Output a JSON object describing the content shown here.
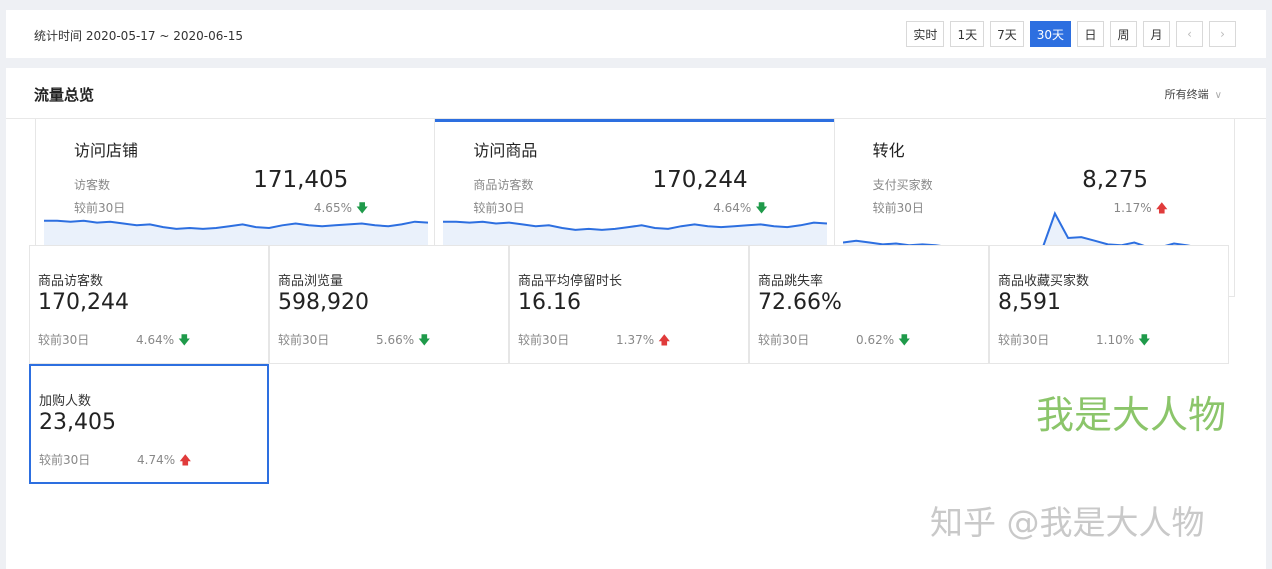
{
  "topbar": {
    "date_range": "统计时间 2020-05-17 ~ 2020-06-15",
    "periods": [
      "实时",
      "1天",
      "7天",
      "30天",
      "日",
      "周",
      "月"
    ],
    "active_period": "30天",
    "prev_icon": "chevron-left-icon",
    "next_icon": "chevron-right-icon"
  },
  "panel": {
    "title": "流量总览",
    "terminal_select": "所有终端"
  },
  "overview": [
    {
      "title": "访问店铺",
      "metric": "访客数",
      "value": "171,405",
      "compare": "较前30日",
      "pct": "4.65%",
      "dir": "down",
      "trend": [
        62,
        62,
        61,
        62,
        60,
        61,
        59,
        57,
        58,
        55,
        53,
        54,
        53,
        54,
        56,
        58,
        55,
        54,
        57,
        59,
        57,
        56,
        57,
        58,
        59,
        57,
        56,
        58,
        61,
        60
      ]
    },
    {
      "title": "访问商品",
      "metric": "商品访客数",
      "value": "170,244",
      "compare": "较前30日",
      "pct": "4.64%",
      "dir": "down",
      "trend": [
        61,
        61,
        60,
        61,
        59,
        60,
        58,
        56,
        57,
        54,
        52,
        53,
        52,
        53,
        55,
        57,
        54,
        53,
        56,
        58,
        56,
        55,
        56,
        57,
        58,
        56,
        55,
        57,
        60,
        59
      ]
    },
    {
      "title": "转化",
      "metric": "支付买家数",
      "value": "8,275",
      "compare": "较前30日",
      "pct": "1.17%",
      "dir": "up",
      "trend": [
        38,
        40,
        38,
        36,
        37,
        35,
        36,
        35,
        33,
        34,
        32,
        31,
        32,
        30,
        29,
        29,
        70,
        43,
        44,
        40,
        36,
        35,
        38,
        33,
        33,
        37,
        35,
        32,
        32,
        29
      ]
    }
  ],
  "metrics": [
    {
      "label": "商品访客数",
      "value": "170,244",
      "compare": "较前30日",
      "pct": "4.64%",
      "dir": "down"
    },
    {
      "label": "商品浏览量",
      "value": "598,920",
      "compare": "较前30日",
      "pct": "5.66%",
      "dir": "down"
    },
    {
      "label": "商品平均停留时长",
      "value": "16.16",
      "compare": "较前30日",
      "pct": "1.37%",
      "dir": "up"
    },
    {
      "label": "商品跳失率",
      "value": "72.66%",
      "compare": "较前30日",
      "pct": "0.62%",
      "dir": "down"
    },
    {
      "label": "商品收藏买家数",
      "value": "8,591",
      "compare": "较前30日",
      "pct": "1.10%",
      "dir": "down"
    },
    {
      "label": "加购人数",
      "value": "23,405",
      "compare": "较前30日",
      "pct": "4.74%",
      "dir": "up"
    }
  ],
  "colors": {
    "accent": "#2d6fe0",
    "down": "#1f9a4a",
    "up": "#e03b3b",
    "area": "#eaf1fb",
    "line": "#2d6fe0"
  },
  "watermarks": {
    "green": "我是大人物",
    "gray": "知乎 @我是大人物"
  }
}
